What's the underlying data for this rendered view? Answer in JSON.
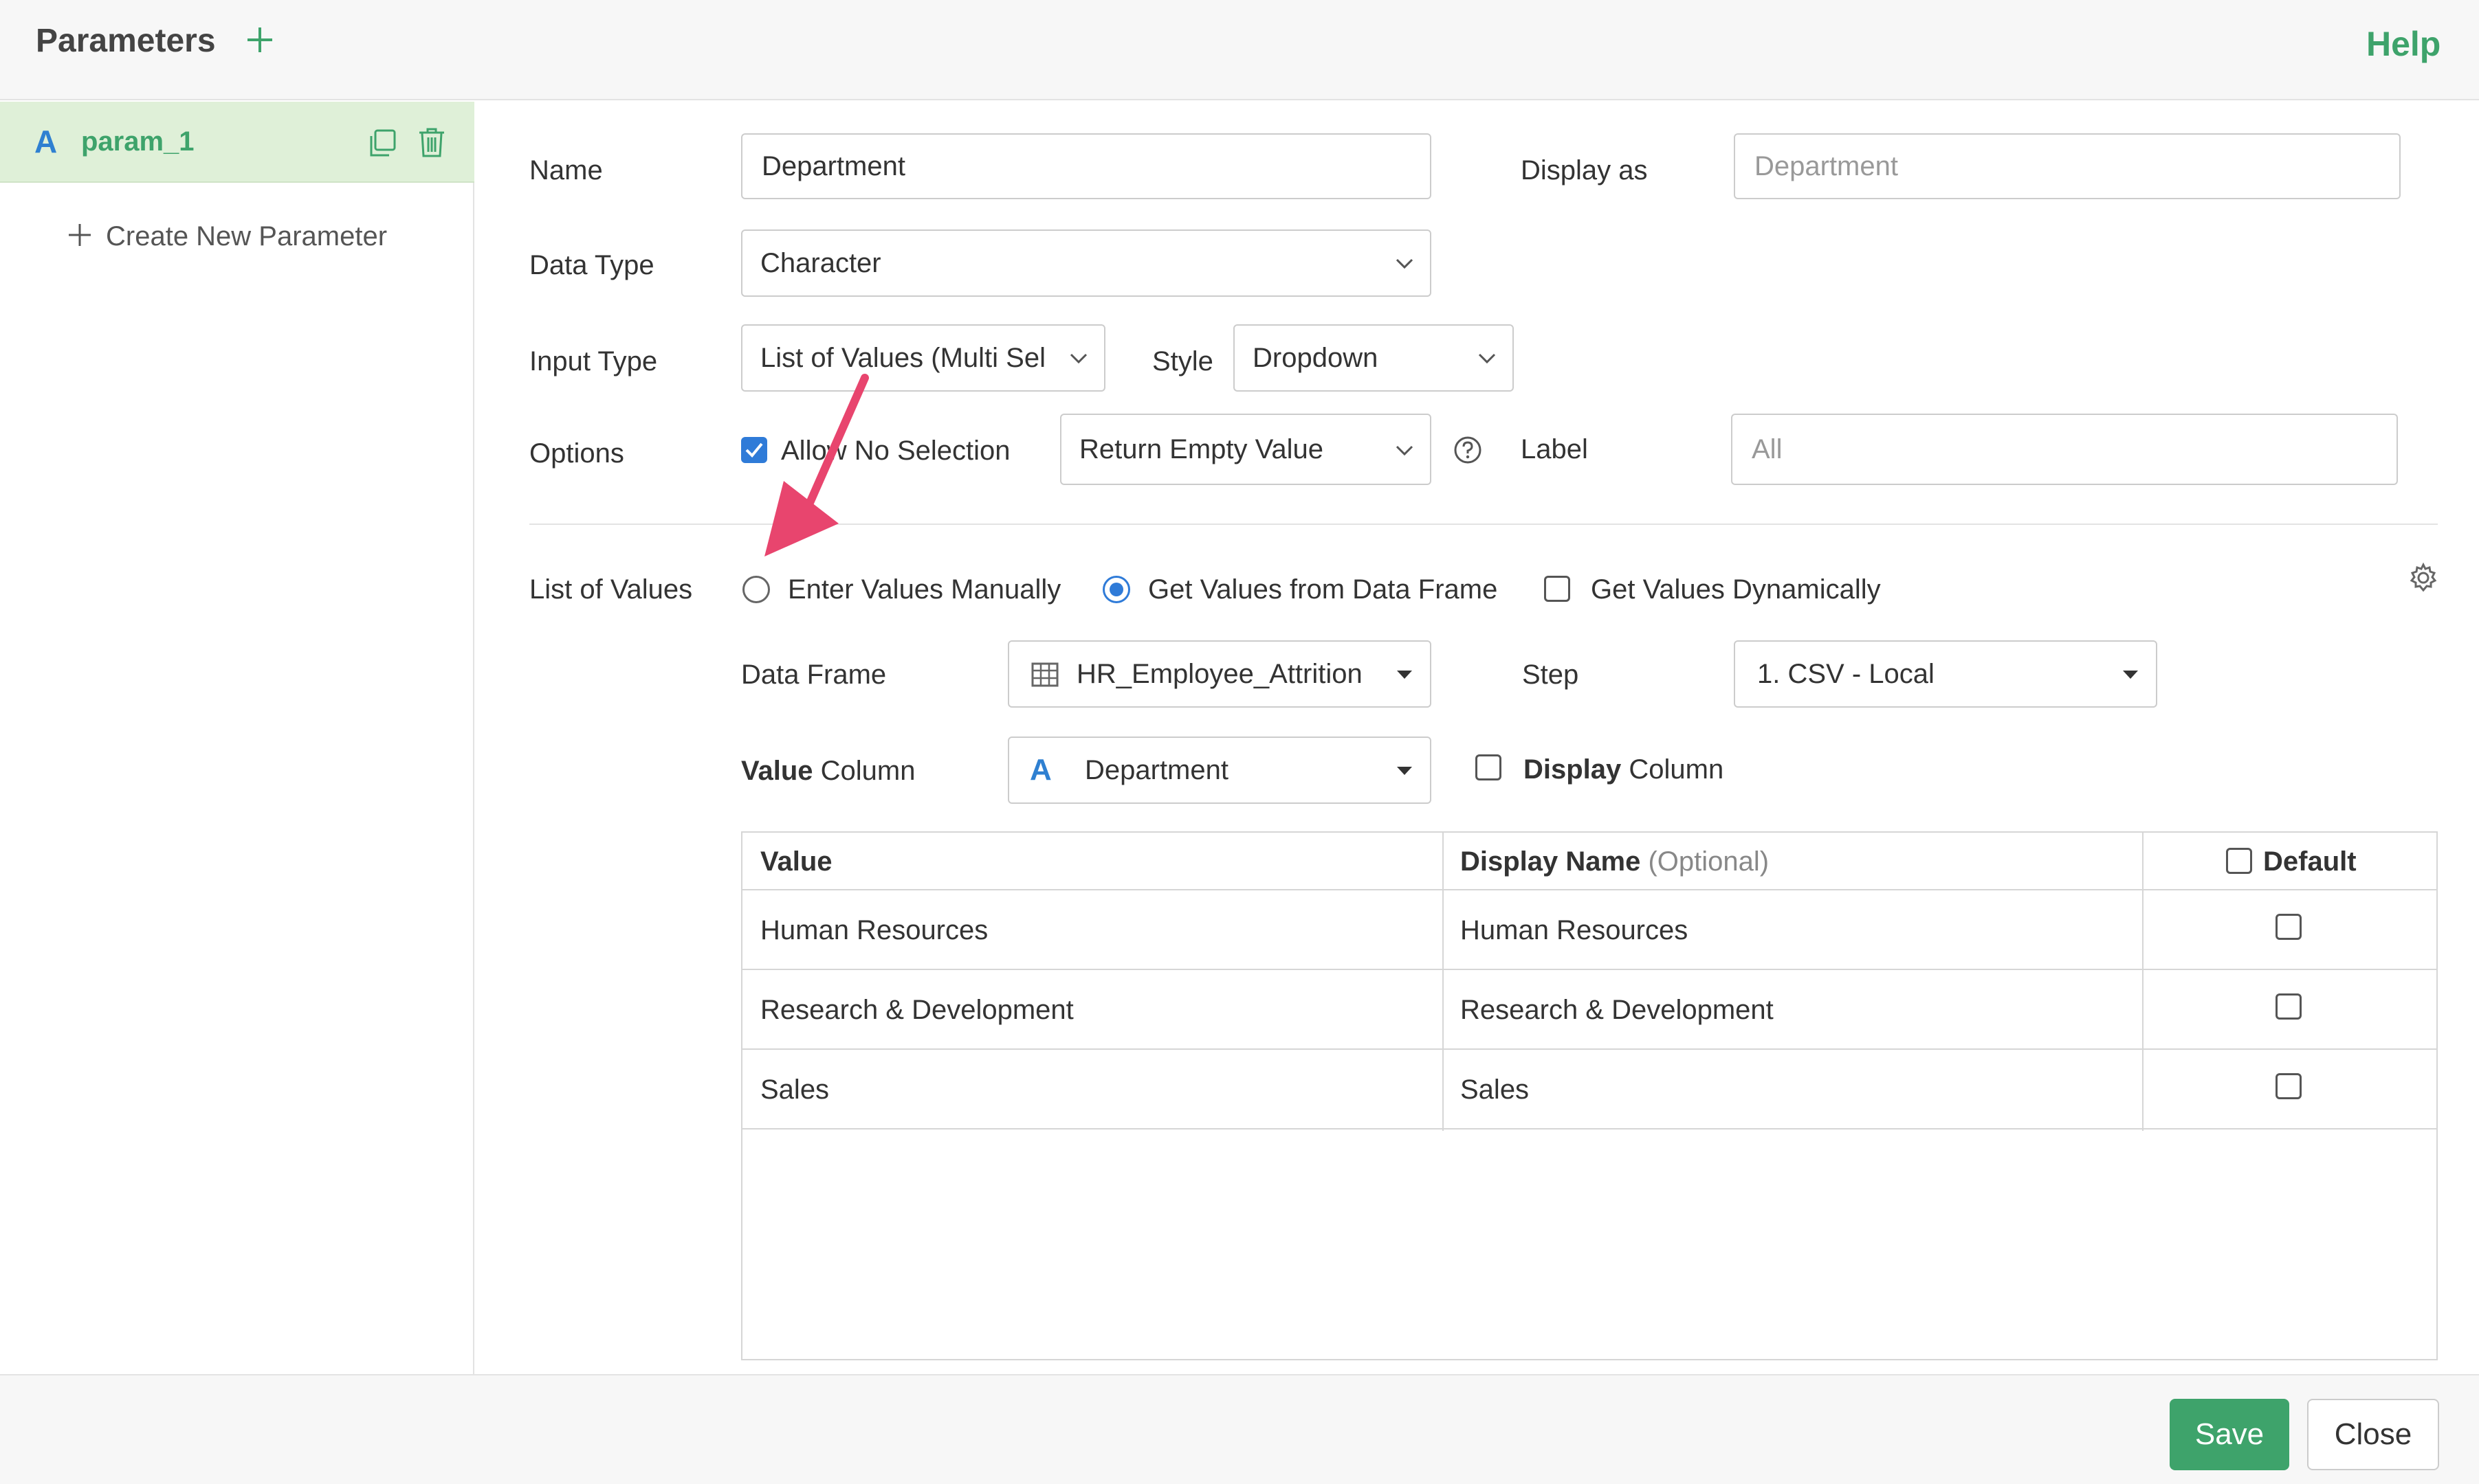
{
  "header": {
    "title": "Parameters",
    "add_icon": "plus-icon",
    "help_label": "Help"
  },
  "sidebar": {
    "parameters": [
      {
        "type_icon": "A",
        "name": "param_1",
        "selected": true
      }
    ],
    "create_new_label": "Create New Parameter"
  },
  "form": {
    "name": {
      "label": "Name",
      "value": "Department"
    },
    "display_as": {
      "label": "Display as",
      "placeholder": "Department"
    },
    "data_type": {
      "label": "Data Type",
      "value": "Character"
    },
    "input_type": {
      "label": "Input Type",
      "value": "List of Values (Multi Sel"
    },
    "style": {
      "label": "Style",
      "value": "Dropdown"
    },
    "options": {
      "label": "Options",
      "allow_no_selection": {
        "label": "Allow No Selection",
        "checked": true
      },
      "empty_behavior": "Return Empty Value",
      "label_field": {
        "label": "Label",
        "placeholder": "All"
      }
    },
    "list_of_values": {
      "label": "List of Values",
      "modes": [
        {
          "label": "Enter Values Manually",
          "selected": false
        },
        {
          "label": "Get Values from Data Frame",
          "selected": true
        }
      ],
      "dynamic": {
        "label": "Get Values Dynamically",
        "checked": false
      },
      "data_frame": {
        "label": "Data Frame",
        "value": "HR_Employee_Attrition"
      },
      "step": {
        "label": "Step",
        "value": "1. CSV - Local"
      },
      "value_column": {
        "label_bold": "Value",
        "label_rest": " Column",
        "type_icon": "A",
        "value": "Department"
      },
      "display_column": {
        "label_bold": "Display",
        "label_rest": " Column",
        "checked": false
      }
    },
    "table": {
      "headers": {
        "value": "Value",
        "display_name": "Display Name",
        "display_name_hint": "(Optional)",
        "default": "Default"
      },
      "rows": [
        {
          "value": "Human Resources",
          "display_name": "Human Resources",
          "default": false
        },
        {
          "value": "Research & Development",
          "display_name": "Research & Development",
          "default": false
        },
        {
          "value": "Sales",
          "display_name": "Sales",
          "default": false
        }
      ]
    }
  },
  "footer": {
    "save_label": "Save",
    "close_label": "Close"
  },
  "colors": {
    "accent_green": "#3ea36b",
    "selection_bg": "#dff0d8",
    "check_blue": "#2f7bd8",
    "annotation_arrow": "#e8456e"
  }
}
